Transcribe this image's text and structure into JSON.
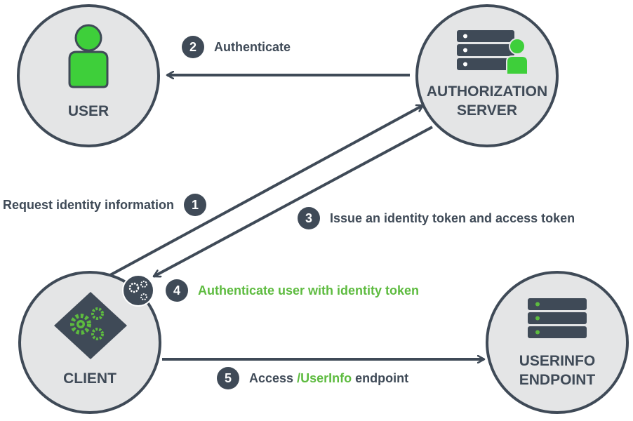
{
  "colors": {
    "node_fill": "#e4e5e6",
    "node_stroke": "#3f4a57",
    "arrow": "#3f4a57",
    "text": "#3f4a57",
    "accent_green": "#5dbb3f",
    "person_green": "#3ecf3a"
  },
  "nodes": {
    "user": {
      "label": "USER",
      "icon": "user-icon"
    },
    "authorization_server": {
      "label_line1": "AUTHORIZATION",
      "label_line2": "SERVER",
      "icon": "server-user-icon"
    },
    "client": {
      "label": "CLIENT",
      "icon": "gears-diamond-icon"
    },
    "userinfo_endpoint": {
      "label_line1": "USERINFO",
      "label_line2": "ENDPOINT",
      "icon": "server-icon"
    }
  },
  "steps": [
    {
      "number": "1",
      "text": "Request identity information"
    },
    {
      "number": "2",
      "text": "Authenticate"
    },
    {
      "number": "3",
      "text": "Issue an identity token and access token"
    },
    {
      "number": "4",
      "text": "Authenticate user with identity token"
    },
    {
      "number": "5",
      "text_before": "Access ",
      "text_highlight": "/UserInfo",
      "text_after": " endpoint"
    }
  ]
}
